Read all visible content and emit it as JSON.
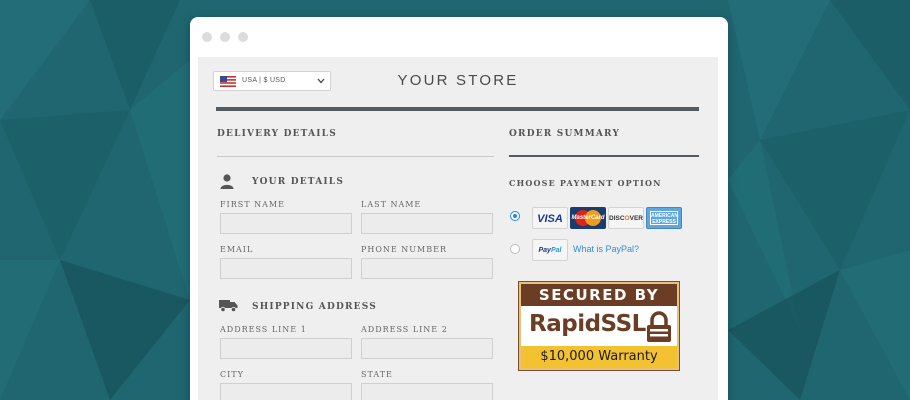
{
  "header": {
    "currency_label": "USA | $ USD",
    "store_title": "YOUR STORE"
  },
  "delivery": {
    "title": "DELIVERY DETAILS",
    "your_details": {
      "title": "YOUR DETAILS",
      "first_name_label": "FIRST NAME",
      "last_name_label": "LAST NAME",
      "email_label": "EMAIL",
      "phone_label": "PHONE NUMBER"
    },
    "shipping": {
      "title": "SHIPPING ADDRESS",
      "address1_label": "ADDRESS LINE 1",
      "address2_label": "ADDRESS LINE 2",
      "city_label": "CITY",
      "state_label": "STATE"
    }
  },
  "summary": {
    "title": "ORDER SUMMARY",
    "payment_title": "CHOOSE PAYMENT OPTION",
    "cards": {
      "visa": "VISA",
      "mastercard": "MasterCard",
      "discover_a": "DISC",
      "discover_o": "O",
      "discover_b": "VER",
      "amex": "AMERICAN EXPRESS",
      "paypal_a": "Pay",
      "paypal_b": "Pal"
    },
    "paypal_link": "What is PayPal?",
    "selected_payment": "card"
  },
  "ssl_badge": {
    "top": "SECURED BY",
    "brand": "RapidSSL.",
    "warranty": "$10,000 Warranty"
  },
  "colors": {
    "background": "#1f6670",
    "accent_blue": "#1e88e5",
    "rule_dark": "#555a5e"
  },
  "icons": [
    "us-flag-icon",
    "chevron-down-icon",
    "user-icon",
    "truck-icon",
    "padlock-icon"
  ]
}
